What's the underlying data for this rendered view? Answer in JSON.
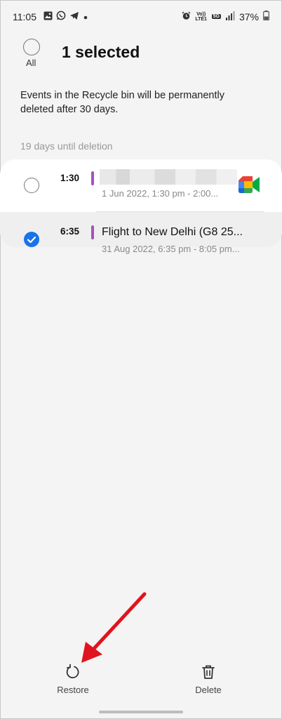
{
  "status_bar": {
    "time": "11:05",
    "volte_label": "Vo)) LTE1",
    "network_label": "5G",
    "battery": "37%"
  },
  "header": {
    "select_all_label": "All",
    "title": "1 selected"
  },
  "info_text": "Events in the Recycle bin will be permanently deleted after 30 days.",
  "section_label": "19 days until deletion",
  "events": [
    {
      "time": "1:30",
      "title": "",
      "subtitle": "1 Jun 2022, 1:30 pm - 2:00...",
      "selected": false,
      "app_icon": "google-meet-icon"
    },
    {
      "time": "6:35",
      "title": "Flight to New Delhi (G8 25...",
      "subtitle": "31 Aug 2022, 6:35 pm - 8:05 pm...",
      "selected": true
    }
  ],
  "actions": {
    "restore_label": "Restore",
    "delete_label": "Delete"
  },
  "colors": {
    "accent": "#1a73e8",
    "event_bar": "#a452c2",
    "arrow": "#e0141e"
  }
}
